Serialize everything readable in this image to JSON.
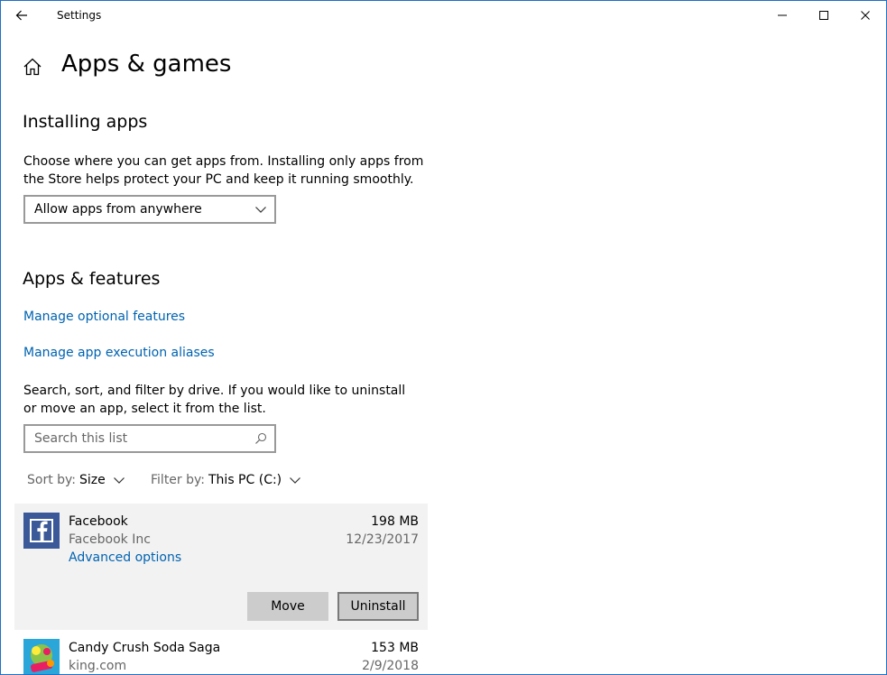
{
  "window": {
    "title": "Settings"
  },
  "header": {
    "title": "Apps & games"
  },
  "installing": {
    "title": "Installing apps",
    "description": "Choose where you can get apps from. Installing only apps from the Store helps protect your PC and keep it running smoothly.",
    "dropdown_value": "Allow apps from anywhere"
  },
  "features": {
    "title": "Apps & features",
    "link_optional": "Manage optional features",
    "link_aliases": "Manage app execution aliases",
    "description": "Search, sort, and filter by drive. If you would like to uninstall or move an app, select it from the list.",
    "search_placeholder": "Search this list",
    "sort_label": "Sort by:",
    "sort_value": "Size",
    "filter_label": "Filter by:",
    "filter_value": "This PC (C:)"
  },
  "apps": [
    {
      "name": "Facebook",
      "publisher": "Facebook Inc",
      "size": "198 MB",
      "date": "12/23/2017",
      "advanced": "Advanced options",
      "move_label": "Move",
      "uninstall_label": "Uninstall",
      "icon": "facebook-icon"
    },
    {
      "name": "Candy Crush Soda Saga",
      "publisher": "king.com",
      "size": "153 MB",
      "date": "2/9/2018",
      "icon": "candy-crush-icon"
    }
  ],
  "colors": {
    "accent": "#0063b1",
    "facebook": "#3b5998",
    "window_border": "#1f6fc4",
    "selected_bg": "#f2f2f2"
  }
}
